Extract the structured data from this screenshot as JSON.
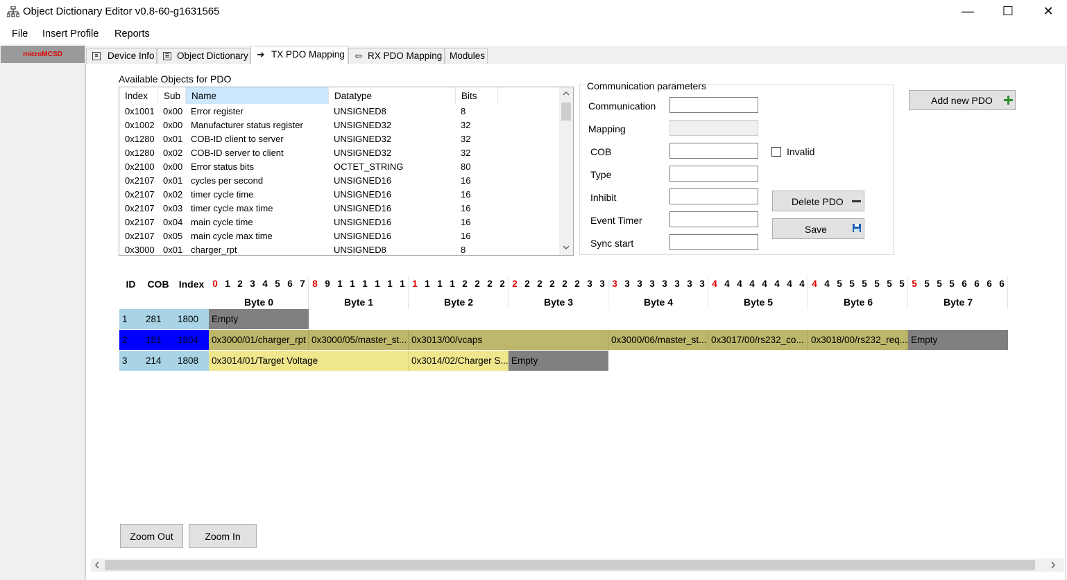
{
  "window": {
    "title": "Object Dictionary Editor v0.8-60-g1631565",
    "minimize": "—",
    "maximize": "☐",
    "close": "✕"
  },
  "menu": [
    "File",
    "Insert Profile",
    "Reports"
  ],
  "sidebar": {
    "device": "microMCSD"
  },
  "tabs": [
    "Device Info",
    "Object Dictionary",
    "TX PDO Mapping",
    "RX PDO Mapping",
    "Modules"
  ],
  "available": {
    "label": "Available Objects for PDO",
    "columns": [
      "Index",
      "Sub",
      "Name",
      "Datatype",
      "Bits"
    ],
    "rows": [
      [
        "0x1001",
        "0x00",
        "Error register",
        "UNSIGNED8",
        "8"
      ],
      [
        "0x1002",
        "0x00",
        "Manufacturer status register",
        "UNSIGNED32",
        "32"
      ],
      [
        "0x1280",
        "0x01",
        "COB-ID client to server",
        "UNSIGNED32",
        "32"
      ],
      [
        "0x1280",
        "0x02",
        "COB-ID server to client",
        "UNSIGNED32",
        "32"
      ],
      [
        "0x2100",
        "0x00",
        "Error status bits",
        "OCTET_STRING",
        "80"
      ],
      [
        "0x2107",
        "0x01",
        "cycles per second",
        "UNSIGNED16",
        "16"
      ],
      [
        "0x2107",
        "0x02",
        "timer cycle time",
        "UNSIGNED16",
        "16"
      ],
      [
        "0x2107",
        "0x03",
        "timer cycle max time",
        "UNSIGNED16",
        "16"
      ],
      [
        "0x2107",
        "0x04",
        "main cycle time",
        "UNSIGNED16",
        "16"
      ],
      [
        "0x2107",
        "0x05",
        "main cycle max time",
        "UNSIGNED16",
        "16"
      ],
      [
        "0x3000",
        "0x01",
        "charger_rpt",
        "UNSIGNED8",
        "8"
      ]
    ]
  },
  "comm": {
    "title": "Communication parameters",
    "fields": [
      "Communication",
      "Mapping",
      "COB",
      "Type",
      "Inhibit",
      "Event Timer",
      "Sync start"
    ],
    "invalid_label": "Invalid",
    "add_pdo": "Add new PDO",
    "delete_pdo": "Delete PDO",
    "save": "Save"
  },
  "grid": {
    "headers": {
      "id": "ID",
      "cob": "COB",
      "index": "Index"
    },
    "bits": [
      "0",
      "1",
      "2",
      "3",
      "4",
      "5",
      "6",
      "7",
      "8",
      "9",
      "1",
      "1",
      "1",
      "1",
      "1",
      "1",
      "1",
      "1",
      "1",
      "1",
      "2",
      "2",
      "2",
      "2",
      "2",
      "2",
      "2",
      "2",
      "2",
      "2",
      "3",
      "3",
      "3",
      "3",
      "3",
      "3",
      "3",
      "3",
      "3",
      "3",
      "4",
      "4",
      "4",
      "4",
      "4",
      "4",
      "4",
      "4",
      "4",
      "4",
      "5",
      "5",
      "5",
      "5",
      "5",
      "5",
      "5",
      "5",
      "5",
      "5",
      "6",
      "6",
      "6",
      "6"
    ],
    "red_bits": [
      0,
      8,
      16,
      24,
      32,
      40,
      48,
      56
    ],
    "bytes": [
      "Byte 0",
      "Byte 1",
      "Byte 2",
      "Byte 3",
      "Byte 4",
      "Byte 5",
      "Byte 6",
      "Byte 7"
    ],
    "rows": [
      {
        "id": "1",
        "cob": "281",
        "index": "1800",
        "selected": false,
        "cells": [
          {
            "label": "Empty",
            "bits": 8,
            "kind": "empty"
          }
        ]
      },
      {
        "id": "2",
        "cob": "181",
        "index": "1804",
        "selected": true,
        "cells": [
          {
            "label": "0x3000/01/charger_rpt",
            "bits": 8,
            "kind": "olive"
          },
          {
            "label": "0x3000/05/master_st...",
            "bits": 8,
            "kind": "olive"
          },
          {
            "label": "0x3013/00/vcaps",
            "bits": 16,
            "kind": "olive"
          },
          {
            "label": "0x3000/06/master_st...",
            "bits": 8,
            "kind": "olive"
          },
          {
            "label": "0x3017/00/rs232_co...",
            "bits": 8,
            "kind": "olive"
          },
          {
            "label": "0x3018/00/rs232_req...",
            "bits": 8,
            "kind": "olive"
          },
          {
            "label": "Empty",
            "bits": 8,
            "kind": "empty"
          }
        ]
      },
      {
        "id": "3",
        "cob": "214",
        "index": "1808",
        "selected": false,
        "cells": [
          {
            "label": "0x3014/01/Target Voltage",
            "bits": 16,
            "kind": "yellow"
          },
          {
            "label": "0x3014/02/Charger  S...",
            "bits": 8,
            "kind": "yellow"
          },
          {
            "label": "Empty",
            "bits": 8,
            "kind": "empty"
          }
        ]
      }
    ]
  },
  "buttons": {
    "zoom_out": "Zoom Out",
    "zoom_in": "Zoom In"
  },
  "scroll": {
    "left": "<",
    "right": ">",
    "down": "⌄"
  }
}
